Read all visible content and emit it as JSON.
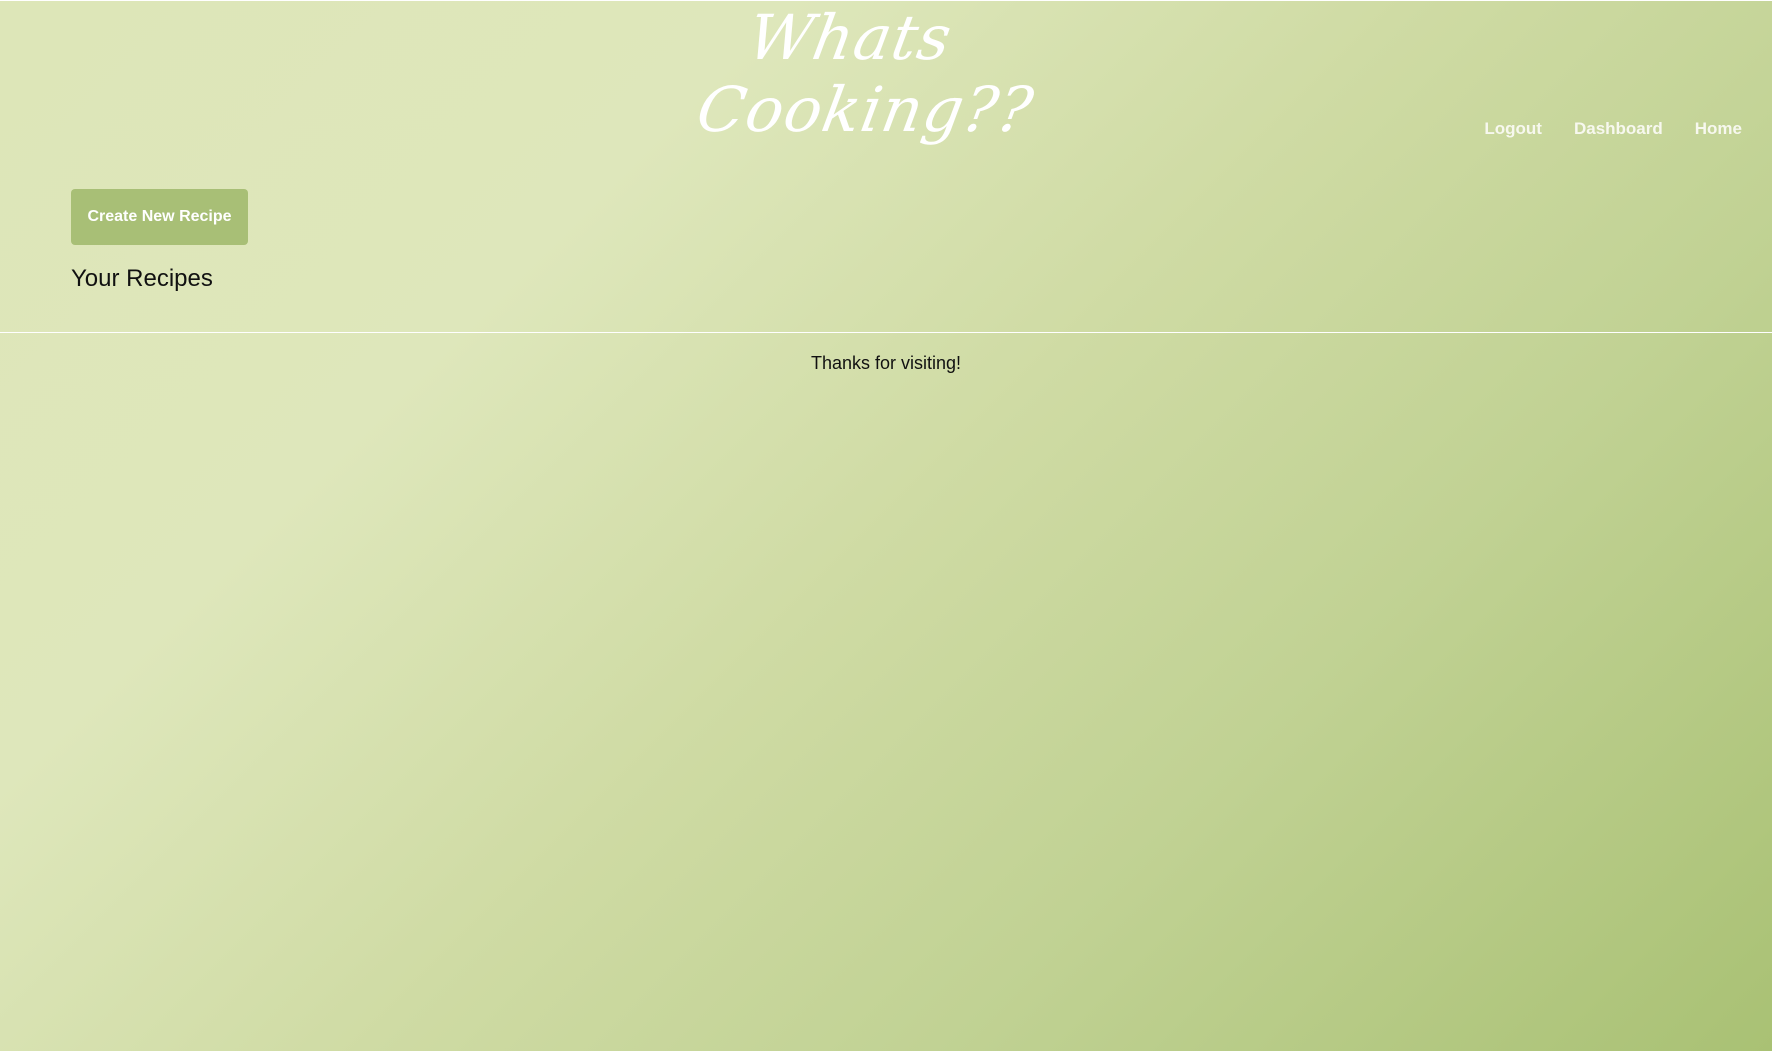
{
  "header": {
    "brand_line1": "Whats",
    "brand_line2": "Cooking??",
    "nav": {
      "logout": "Logout",
      "dashboard": "Dashboard",
      "home": "Home"
    }
  },
  "main": {
    "create_button_label": "Create New Recipe",
    "section_title": "Your Recipes"
  },
  "footer": {
    "message": "Thanks for visiting!"
  },
  "colors": {
    "background_light": "#dde6b8",
    "background_dark": "#a9c174",
    "button": "#a8bf76",
    "brand_text": "#ffffff",
    "nav_text": "#f7f8ef",
    "body_text": "#111111"
  }
}
